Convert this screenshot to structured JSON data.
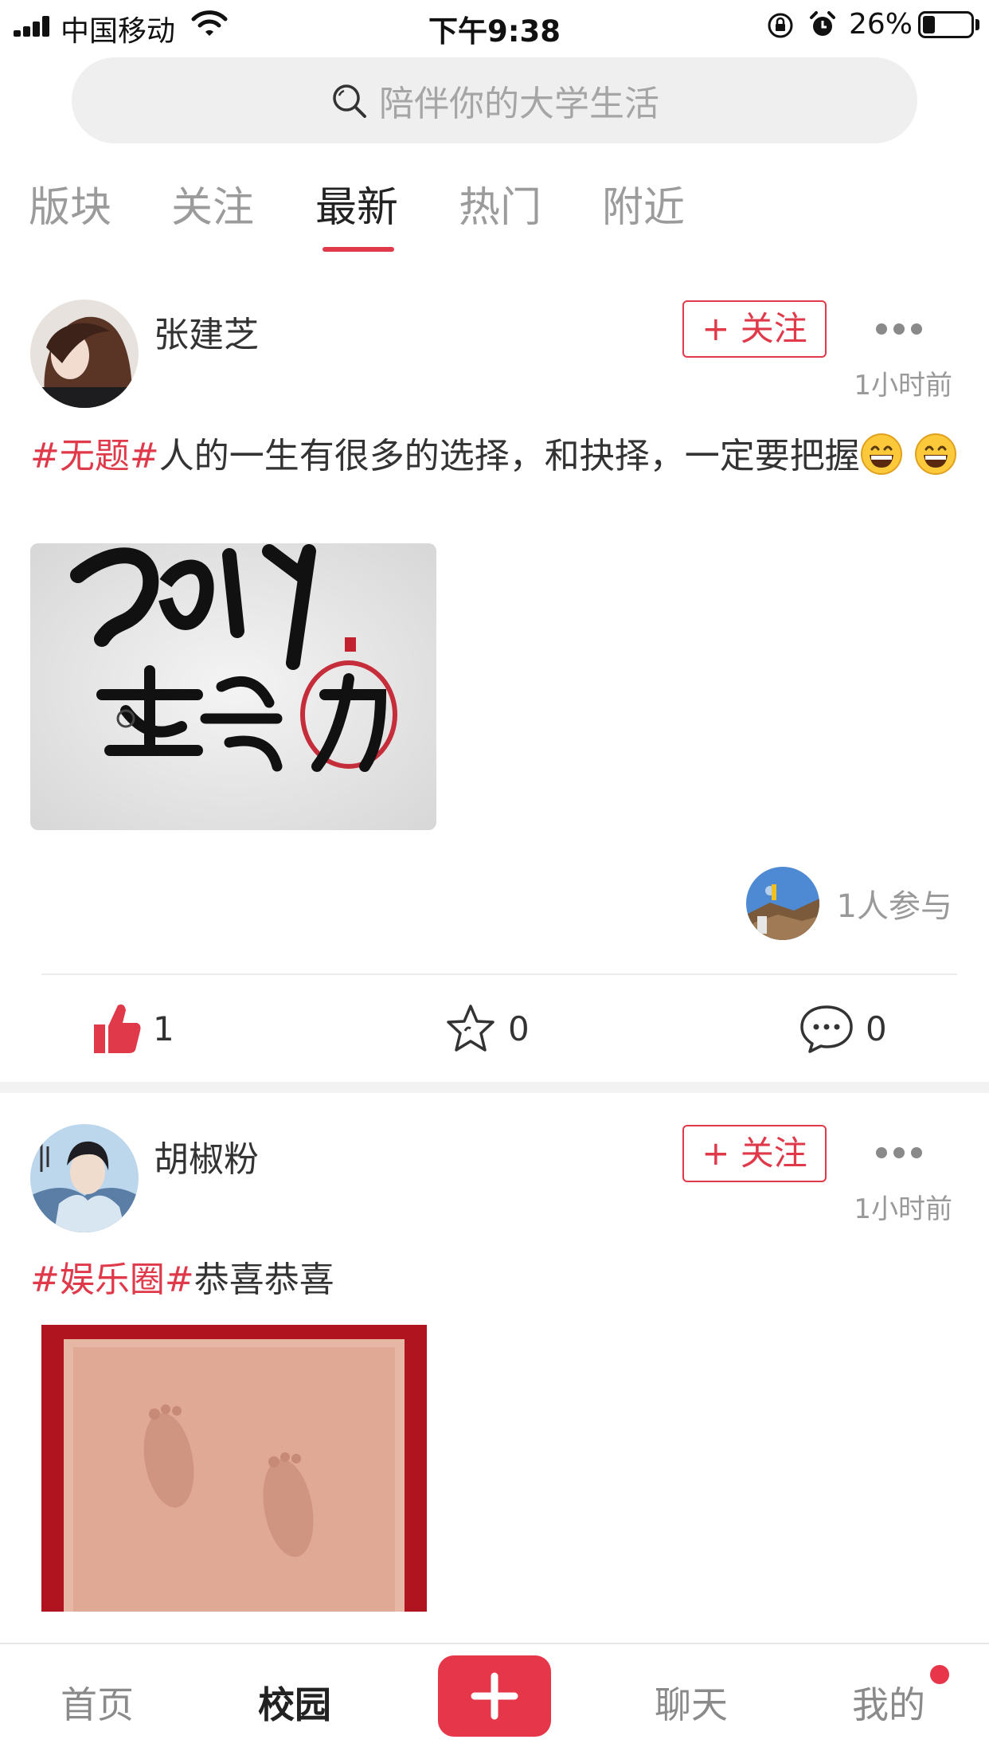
{
  "status_bar": {
    "carrier": "中国移动",
    "time": "下午9:38",
    "battery_percent": "26%",
    "battery_level": 0.26
  },
  "search": {
    "placeholder": "陪伴你的大学生活",
    "icon": "search-icon"
  },
  "tabs": [
    {
      "label": "版块",
      "active": false
    },
    {
      "label": "关注",
      "active": false
    },
    {
      "label": "最新",
      "active": true
    },
    {
      "label": "热门",
      "active": false
    },
    {
      "label": "附近",
      "active": false
    }
  ],
  "colors": {
    "accent": "#e0394a",
    "muted_text": "#999999",
    "search_bg": "#efefef"
  },
  "posts": [
    {
      "username": "张建芝",
      "follow_label": "+ 关注",
      "time": "1小时前",
      "tag": "#无题#",
      "text": "人的一生有很多的选择，和抉择，一定要把握",
      "emoji": "grinning-face-emoji",
      "participants": "1人参与",
      "likes": "1",
      "favorites": "0",
      "comments": "0"
    },
    {
      "username": "胡椒粉",
      "follow_label": "+ 关注",
      "time": "1小时前",
      "tag": "#娱乐圈#",
      "text": "恭喜恭喜"
    }
  ],
  "bottom_nav": {
    "items": [
      {
        "label": "首页",
        "active": false
      },
      {
        "label": "校园",
        "active": true
      },
      {
        "label": "聊天",
        "active": false
      },
      {
        "label": "我的",
        "active": false
      }
    ],
    "add_icon": "plus-icon",
    "notification_dot": true
  }
}
